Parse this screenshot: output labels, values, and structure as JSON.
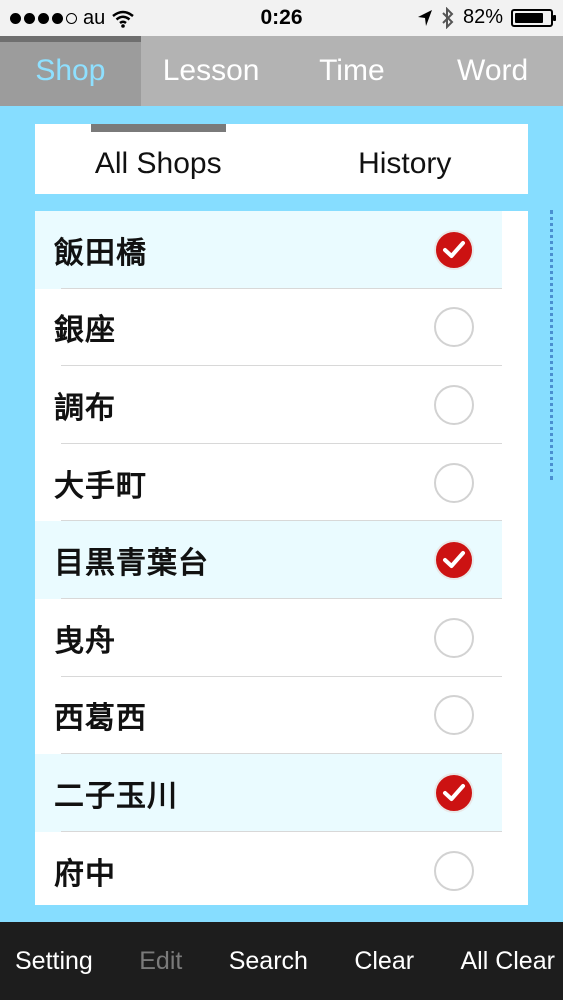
{
  "status_bar": {
    "carrier": "au",
    "time": "0:26",
    "battery": "82%",
    "battery_level": 0.82,
    "icons": [
      "signal-dots-icon",
      "wifi-icon",
      "location-arrow-icon",
      "bluetooth-icon",
      "battery-icon"
    ]
  },
  "top_tabs": [
    {
      "label": "Shop",
      "active": true
    },
    {
      "label": "Lesson",
      "active": false
    },
    {
      "label": "Time",
      "active": false
    },
    {
      "label": "Word",
      "active": false
    }
  ],
  "sub_tabs": [
    {
      "label": "All Shops",
      "active": true
    },
    {
      "label": "History",
      "active": false
    }
  ],
  "shops": [
    {
      "name": "飯田橋",
      "checked": true
    },
    {
      "name": "銀座",
      "checked": false
    },
    {
      "name": "調布",
      "checked": false
    },
    {
      "name": "大手町",
      "checked": false
    },
    {
      "name": "目黒青葉台",
      "checked": true
    },
    {
      "name": "曳舟",
      "checked": false
    },
    {
      "name": "西葛西",
      "checked": false
    },
    {
      "name": "二子玉川",
      "checked": true
    },
    {
      "name": "府中",
      "checked": false
    }
  ],
  "toolbar": {
    "setting": "Setting",
    "edit": "Edit",
    "search": "Search",
    "clear": "Clear",
    "all_clear": "All Clear"
  },
  "colors": {
    "background": "#86ddff",
    "check_red": "#cc1212",
    "active_tab_text": "#8ee0ff",
    "toolbar_bg": "#1d1d1d"
  }
}
